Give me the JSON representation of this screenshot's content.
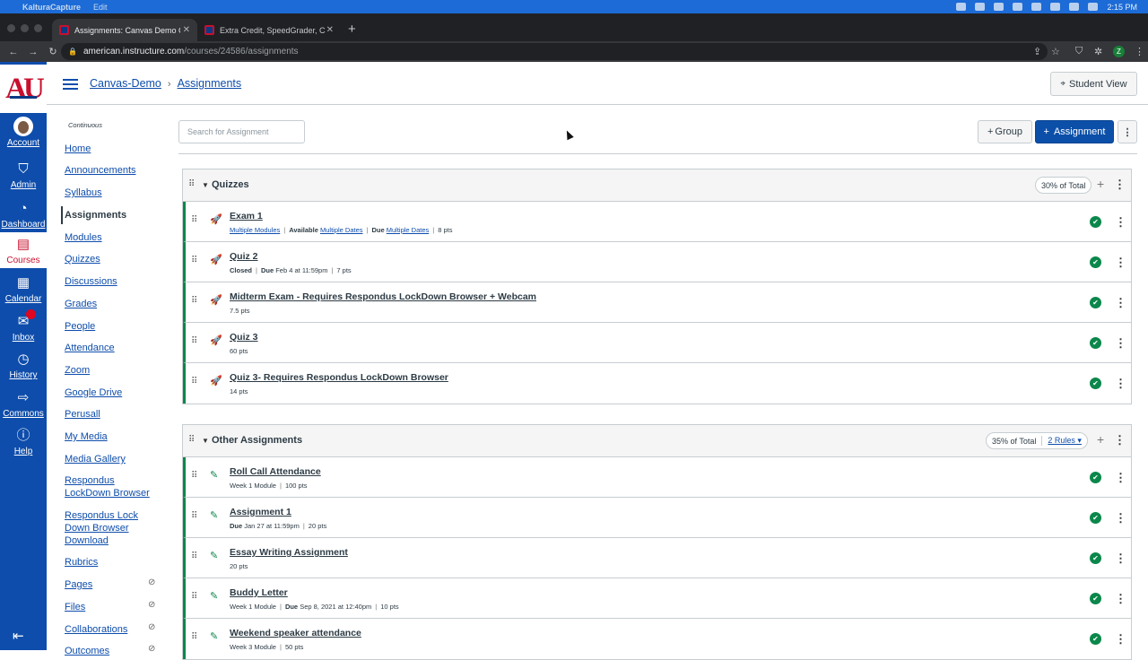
{
  "menubar": {
    "app": "KalturaCapture",
    "edit": "Edit",
    "time": "2:15 PM"
  },
  "browser": {
    "tabs": [
      {
        "title": "Assignments: Canvas Demo Co"
      },
      {
        "title": "Extra Credit, SpeedGrader, Ca"
      }
    ],
    "url_host": "american.instructure.com",
    "url_path": "/courses/24586/assignments",
    "profile_initial": "Z"
  },
  "global_nav": [
    {
      "label": "Account",
      "icon": "avatar"
    },
    {
      "label": "Admin",
      "icon": "shield-icon"
    },
    {
      "label": "Dashboard",
      "icon": "speedometer-icon"
    },
    {
      "label": "Courses",
      "icon": "book-icon"
    },
    {
      "label": "Calendar",
      "icon": "calendar-icon"
    },
    {
      "label": "Inbox",
      "icon": "inbox-icon"
    },
    {
      "label": "History",
      "icon": "clock-icon"
    },
    {
      "label": "Commons",
      "icon": "commons-icon"
    },
    {
      "label": "Help",
      "icon": "help-icon"
    }
  ],
  "breadcrumb": {
    "course": "Canvas-Demo",
    "page": "Assignments"
  },
  "student_view_label": "Student View",
  "course_nav": {
    "continuous": "Continuous",
    "items": [
      "Home",
      "Announcements",
      "Syllabus",
      "Assignments",
      "Modules",
      "Quizzes",
      "Discussions",
      "Grades",
      "People",
      "Attendance",
      "Zoom",
      "Google Drive",
      "Perusall",
      "My Media",
      "Media Gallery",
      "Respondus LockDown Browser",
      "Respondus Lock Down Browser Download",
      "Rubrics",
      "Pages",
      "Files",
      "Collaborations",
      "Outcomes"
    ]
  },
  "search": {
    "placeholder": "Search for Assignment"
  },
  "buttons": {
    "group": "Group",
    "assignment": "Assignment"
  },
  "groups": [
    {
      "name": "Quizzes",
      "weight": "30% of Total",
      "items": [
        {
          "title": "Exam 1",
          "meta": [
            [
              "lk",
              "Multiple Modules"
            ],
            [
              "bar"
            ],
            [
              "b",
              "Available"
            ],
            [
              "t",
              " "
            ],
            [
              "lk",
              "Multiple Dates"
            ],
            [
              "bar"
            ],
            [
              "b",
              "Due"
            ],
            [
              "t",
              " "
            ],
            [
              "lk",
              "Multiple Dates"
            ],
            [
              "bar"
            ],
            [
              "t",
              "8 pts"
            ]
          ]
        },
        {
          "title": "Quiz 2",
          "meta": [
            [
              "b",
              "Closed"
            ],
            [
              "bar"
            ],
            [
              "b",
              "Due"
            ],
            [
              "t",
              " Feb 4 at 11:59pm"
            ],
            [
              "bar"
            ],
            [
              "t",
              "7 pts"
            ]
          ]
        },
        {
          "title": "Midterm Exam - Requires Respondus LockDown Browser + Webcam",
          "meta": [
            [
              "t",
              "7.5 pts"
            ]
          ]
        },
        {
          "title": "Quiz 3",
          "meta": [
            [
              "t",
              "60 pts"
            ]
          ]
        },
        {
          "title": "Quiz 3- Requires Respondus LockDown Browser",
          "meta": [
            [
              "t",
              "14 pts"
            ]
          ]
        }
      ]
    },
    {
      "name": "Other Assignments",
      "weight": "35% of Total",
      "rules": "2 Rules",
      "items": [
        {
          "title": "Roll Call Attendance",
          "meta": [
            [
              "t",
              "Week 1 Module"
            ],
            [
              "bar"
            ],
            [
              "t",
              "100 pts"
            ]
          ]
        },
        {
          "title": "Assignment 1",
          "meta": [
            [
              "b",
              "Due"
            ],
            [
              "t",
              " Jan 27 at 11:59pm"
            ],
            [
              "bar"
            ],
            [
              "t",
              "20 pts"
            ]
          ]
        },
        {
          "title": "Essay Writing Assignment",
          "meta": [
            [
              "t",
              "20 pts"
            ]
          ]
        },
        {
          "title": "Buddy Letter",
          "meta": [
            [
              "t",
              "Week 1 Module"
            ],
            [
              "bar"
            ],
            [
              "b",
              "Due"
            ],
            [
              "t",
              " Sep 8, 2021 at 12:40pm"
            ],
            [
              "bar"
            ],
            [
              "t",
              "10 pts"
            ]
          ]
        },
        {
          "title": "Weekend speaker attendance",
          "meta": [
            [
              "t",
              "Week 3 Module"
            ],
            [
              "bar"
            ],
            [
              "t",
              "50 pts"
            ]
          ]
        }
      ]
    }
  ]
}
